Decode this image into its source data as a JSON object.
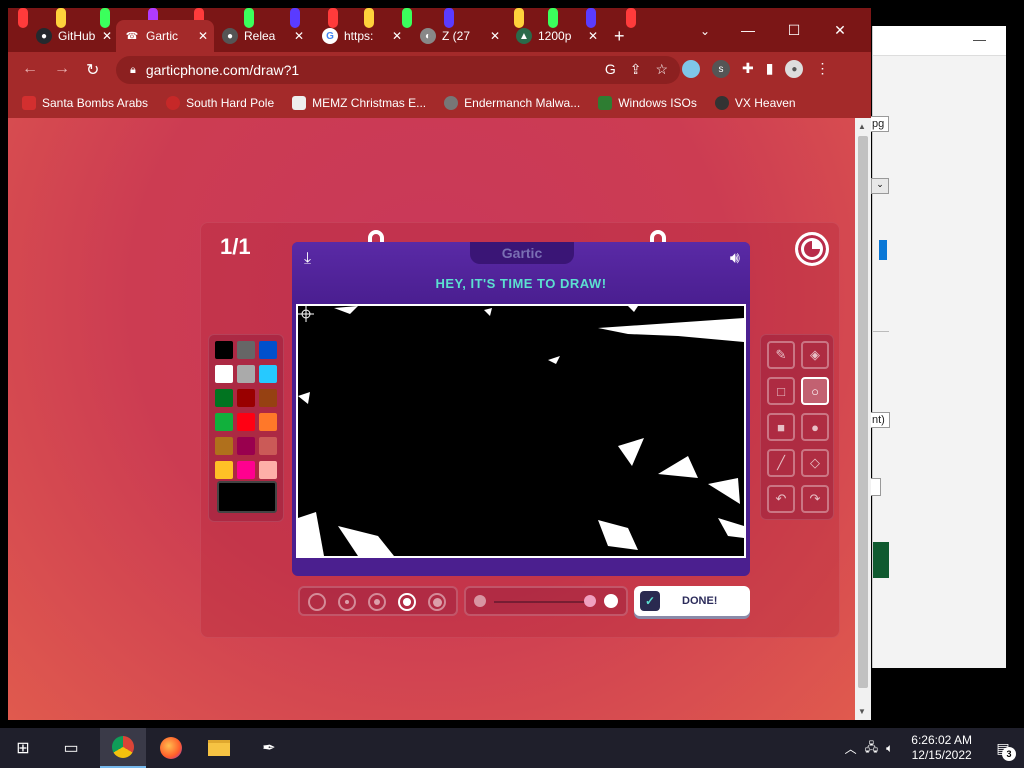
{
  "browser": {
    "tabs": [
      {
        "label": "GitHub",
        "favicon_color": "#24292e"
      },
      {
        "label": "Gartic",
        "favicon_color": "#7b2fbe",
        "active": true
      },
      {
        "label": "Relea",
        "favicon_color": "#555555"
      },
      {
        "label": "https:",
        "favicon_color": "#4285f4"
      },
      {
        "label": "Z (27",
        "favicon_color": "#888888"
      },
      {
        "label": "1200p",
        "favicon_color": "#2a6a4a"
      }
    ],
    "url": "garticphone.com/draw?1",
    "bookmarks": [
      {
        "label": "Santa Bombs Arabs",
        "icon_color": "#d32f2f"
      },
      {
        "label": "South Hard Pole",
        "icon_color": "#c62828"
      },
      {
        "label": "MEMZ Christmas E...",
        "icon_color": "#eeeeee"
      },
      {
        "label": "Endermanch Malwa...",
        "icon_color": "#555555"
      },
      {
        "label": "Windows ISOs",
        "icon_color": "#2e7d32"
      },
      {
        "label": "VX Heaven",
        "icon_color": "#333333"
      }
    ]
  },
  "game": {
    "round_counter": "1/1",
    "logo": "Gartic",
    "headline": "HEY, IT'S TIME TO DRAW!",
    "done_label": "DONE!",
    "current_color": "#000000",
    "palette": [
      "#000000",
      "#666666",
      "#0050cd",
      "#ffffff",
      "#aaaaaa",
      "#26c9ff",
      "#017420",
      "#990000",
      "#964112",
      "#11b03c",
      "#ff0013",
      "#ff7829",
      "#b0701c",
      "#99004e",
      "#cb5a57",
      "#ffc126",
      "#ff008f",
      "#feafa8"
    ],
    "tools": [
      {
        "name": "pencil",
        "icon": "✎"
      },
      {
        "name": "eraser",
        "icon": "◈"
      },
      {
        "name": "rectangle",
        "icon": "□"
      },
      {
        "name": "ellipse",
        "icon": "○",
        "active": true
      },
      {
        "name": "filled-rectangle",
        "icon": "■"
      },
      {
        "name": "filled-ellipse",
        "icon": "●"
      },
      {
        "name": "line",
        "icon": "╱"
      },
      {
        "name": "fill-bucket",
        "icon": "◇"
      },
      {
        "name": "undo",
        "icon": "↶"
      },
      {
        "name": "redo",
        "icon": "↷"
      }
    ],
    "brush_sizes": [
      1,
      2,
      3,
      4,
      5
    ],
    "selected_brush_size": 4
  },
  "taskbar": {
    "time": "6:26:02 AM",
    "date": "12/15/2022",
    "notification_count": "3"
  }
}
